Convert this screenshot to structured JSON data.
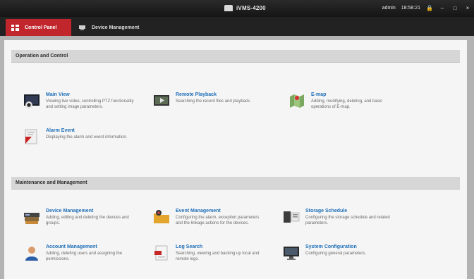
{
  "window": {
    "title": "iVMS-4200",
    "user": "admin",
    "time": "18:58:21",
    "controls": [
      "lock",
      "minimize",
      "maximize",
      "close"
    ]
  },
  "tabs": [
    {
      "label": "Control Panel",
      "icon": "grid-icon",
      "active": true
    },
    {
      "label": "Device Management",
      "icon": "device-icon",
      "active": false
    }
  ],
  "sections": [
    {
      "title": "Operation and Control",
      "items": [
        {
          "name": "Main View",
          "desc": "Viewing live video, controlling PTZ functionality and setting image parameters."
        },
        {
          "name": "Remote Playback",
          "desc": "Searching the record files and playback."
        },
        {
          "name": "E-map",
          "desc": "Adding, modifying, deleting, and basic operations of E-map."
        },
        {
          "name": "Alarm Event",
          "desc": "Displaying the alarm and event information."
        }
      ]
    },
    {
      "title": "Maintenance and Management",
      "items": [
        {
          "name": "Device Management",
          "desc": "Adding, editing and deleting the devices and groups."
        },
        {
          "name": "Event Management",
          "desc": "Configuring the alarm, exception parameters and the linkage actions for the devices."
        },
        {
          "name": "Storage Schedule",
          "desc": "Configuring the storage schedule and related parameters."
        },
        {
          "name": "Account Management",
          "desc": "Adding, deleting users and assigning the permissions."
        },
        {
          "name": "Log Search",
          "desc": "Searching, viewing and backing up local and remote logs."
        },
        {
          "name": "System Configuration",
          "desc": "Configuring general parameters."
        }
      ]
    }
  ],
  "colors": {
    "accent": "#c0262c",
    "link": "#1f6fb8",
    "header": "#d6d6d6",
    "background": "#f5f5f5"
  }
}
